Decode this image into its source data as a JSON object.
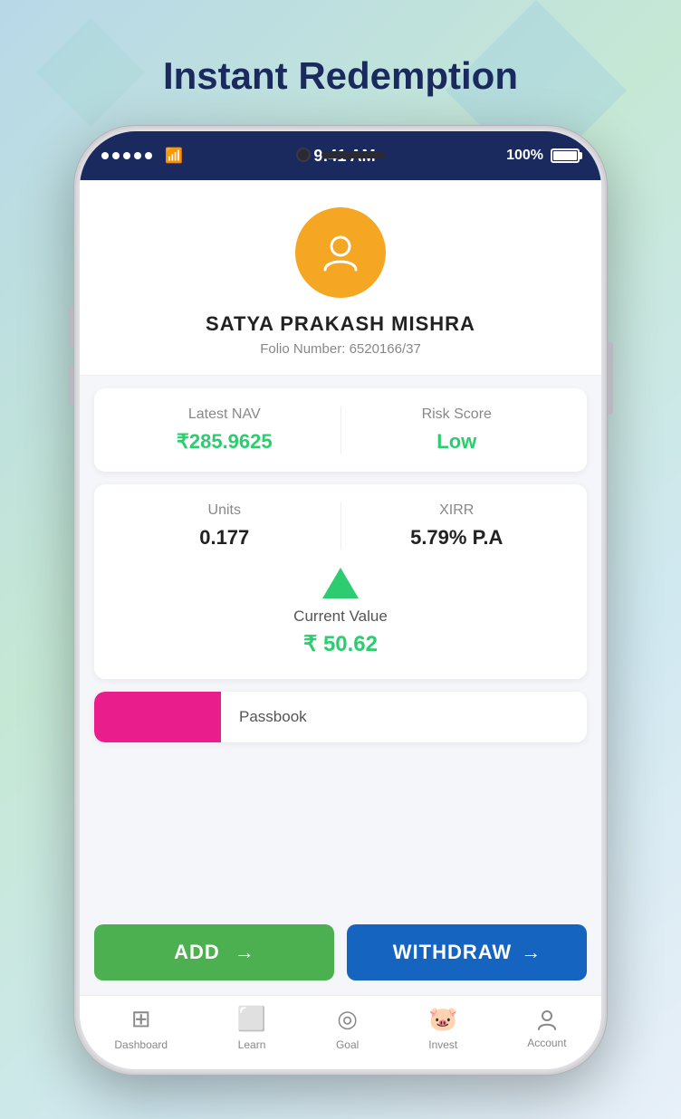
{
  "page": {
    "title": "Instant Redemption"
  },
  "status_bar": {
    "time": "9:41 AM",
    "battery": "100%",
    "dots": [
      "●",
      "●",
      "●",
      "●",
      "●"
    ]
  },
  "profile": {
    "name": "SATYA PRAKASH MISHRA",
    "folio_label": "Folio Number:",
    "folio_number": "6520166/37"
  },
  "nav_card": {
    "nav_label": "Latest NAV",
    "nav_value": "₹285.9625",
    "risk_label": "Risk Score",
    "risk_value": "Low"
  },
  "units_card": {
    "units_label": "Units",
    "units_value": "0.177",
    "xirr_label": "XIRR",
    "xirr_value": "5.79% P.A",
    "current_label": "Current Value",
    "current_value": "₹ 50.62"
  },
  "passbook": {
    "label": "Passbook"
  },
  "buttons": {
    "add_label": "ADD",
    "withdraw_label": "WITHDRAW"
  },
  "bottom_nav": [
    {
      "label": "Dashboard",
      "icon": "⊞"
    },
    {
      "label": "Learn",
      "icon": "▭"
    },
    {
      "label": "Goal",
      "icon": "◎"
    },
    {
      "label": "Invest",
      "icon": "🐷"
    },
    {
      "label": "Account",
      "icon": "👤"
    }
  ]
}
